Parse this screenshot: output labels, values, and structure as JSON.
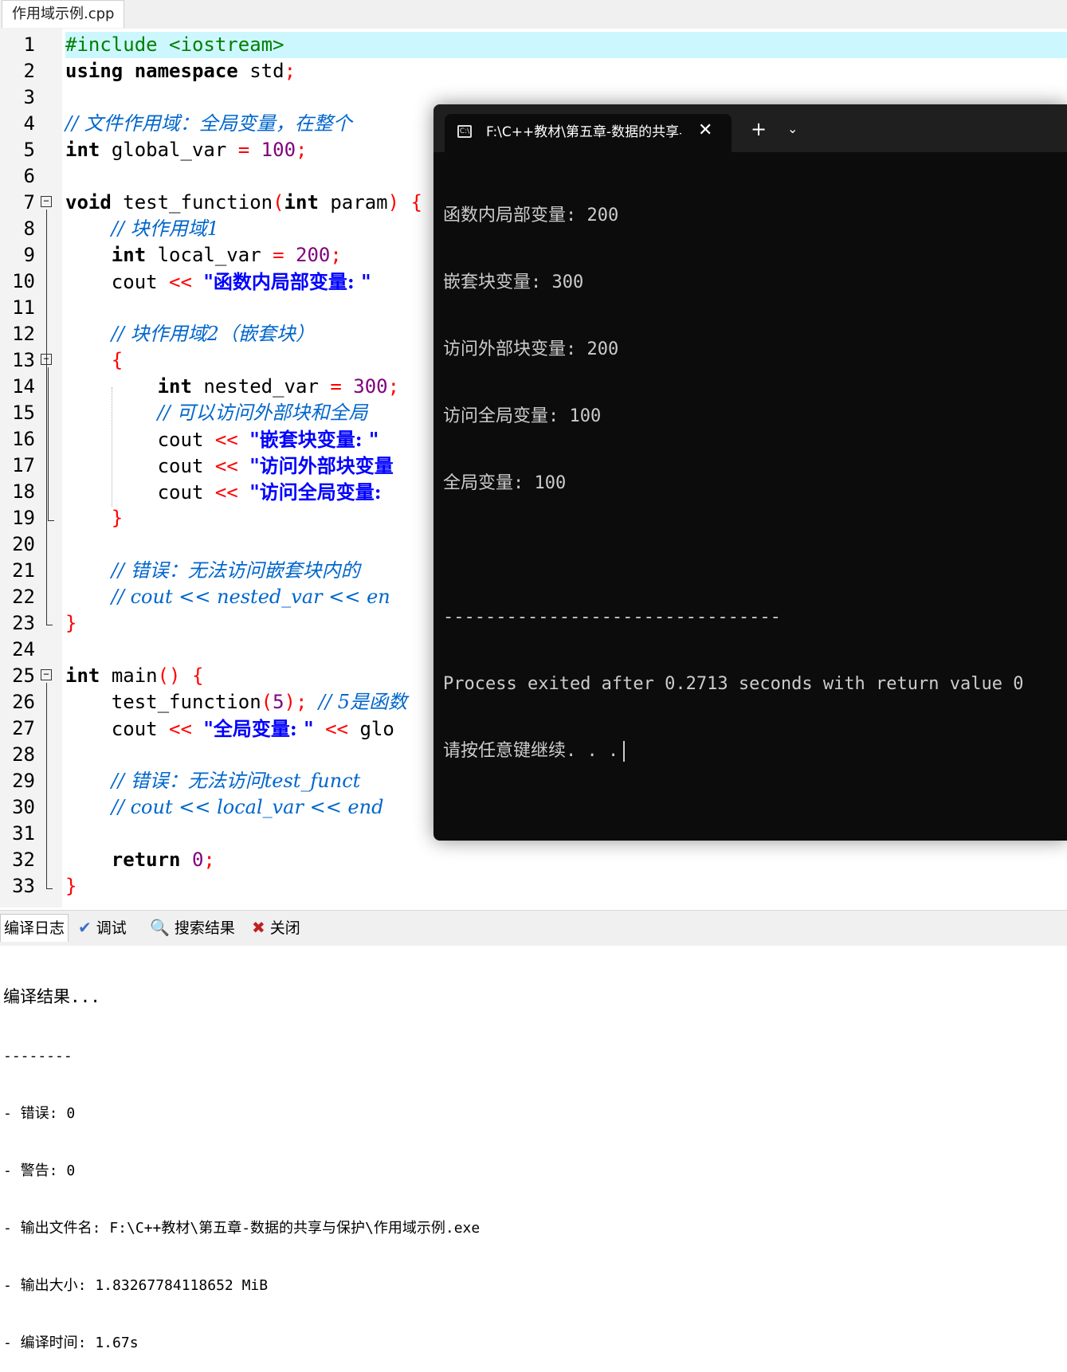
{
  "file_tab": "作用域示例.cpp",
  "code": {
    "l1": {
      "n": "1",
      "pp": "#include <iostream>"
    },
    "l2": {
      "n": "2",
      "kw1": "using",
      "kw2": "namespace",
      "rest": "std",
      "semi": ";"
    },
    "l3": {
      "n": "3"
    },
    "l4": {
      "n": "4",
      "cmt": "// 文件作用域：全局变量，在整个"
    },
    "l5": {
      "n": "5",
      "kw": "int",
      "name": "global_var",
      "eq": "=",
      "num": "100",
      "semi": ";"
    },
    "l6": {
      "n": "6"
    },
    "l7": {
      "n": "7",
      "kw": "void",
      "name": "test_function",
      "p1": "(",
      "kw2": "int",
      "param": "param",
      "p2": ")",
      "brace": "{"
    },
    "l8": {
      "n": "8",
      "cmt": "// 块作用域1"
    },
    "l9": {
      "n": "9",
      "kw": "int",
      "name": "local_var",
      "eq": "=",
      "num": "200",
      "semi": ";"
    },
    "l10": {
      "n": "10",
      "name": "cout",
      "op": "<<",
      "str": "\"函数内局部变量: \""
    },
    "l11": {
      "n": "11"
    },
    "l12": {
      "n": "12",
      "cmt": "// 块作用域2（嵌套块）"
    },
    "l13": {
      "n": "13",
      "brace": "{"
    },
    "l14": {
      "n": "14",
      "kw": "int",
      "name": "nested_var",
      "eq": "=",
      "num": "300",
      "semi": ";"
    },
    "l15": {
      "n": "15",
      "cmt": "// 可以访问外部块和全局"
    },
    "l16": {
      "n": "16",
      "name": "cout",
      "op": "<<",
      "str": "\"嵌套块变量: \""
    },
    "l17": {
      "n": "17",
      "name": "cout",
      "op": "<<",
      "str": "\"访问外部块变量"
    },
    "l18": {
      "n": "18",
      "name": "cout",
      "op": "<<",
      "str": "\"访问全局变量:"
    },
    "l19": {
      "n": "19",
      "brace": "}"
    },
    "l20": {
      "n": "20"
    },
    "l21": {
      "n": "21",
      "cmt": "// 错误：无法访问嵌套块内的"
    },
    "l22": {
      "n": "22",
      "cmt": "// cout << nested_var << en"
    },
    "l23": {
      "n": "23",
      "brace": "}"
    },
    "l24": {
      "n": "24"
    },
    "l25": {
      "n": "25",
      "kw": "int",
      "name": "main",
      "p": "()",
      "brace": "{"
    },
    "l26": {
      "n": "26",
      "name": "test_function",
      "p1": "(",
      "num": "5",
      "p2": ")",
      "semi": ";",
      "cmt": "// 5是函数"
    },
    "l27": {
      "n": "27",
      "name": "cout",
      "op": "<<",
      "str": "\"全局变量: \"",
      "op2": "<<",
      "rest": "glo"
    },
    "l28": {
      "n": "28"
    },
    "l29": {
      "n": "29",
      "cmt": "// 错误：无法访问test_funct"
    },
    "l30": {
      "n": "30",
      "cmt": "// cout << local_var << end"
    },
    "l31": {
      "n": "31"
    },
    "l32": {
      "n": "32",
      "kw": "return",
      "num": "0",
      "semi": ";"
    },
    "l33": {
      "n": "33",
      "brace": "}"
    }
  },
  "console": {
    "tab_title": "F:\\C++教材\\第五章-数据的共享与保护\\作用域示例.exe",
    "tab_icon": "C:\\",
    "close": "✕",
    "new_tab": "+",
    "dropdown": "⌄",
    "lines": [
      "函数内局部变量: 200",
      "嵌套块变量: 300",
      "访问外部块变量: 200",
      "访问全局变量: 100",
      "全局变量: 100",
      "",
      "--------------------------------",
      "Process exited after 0.2713 seconds with return value 0",
      "请按任意键继续. . ."
    ]
  },
  "bottom_tabs": [
    {
      "label": "编译日志",
      "icon": ""
    },
    {
      "label": "调试",
      "icon": "✔"
    },
    {
      "label": "搜索结果",
      "icon": "🔍"
    },
    {
      "label": "关闭",
      "icon": "✖"
    }
  ],
  "log": {
    "title": "编译结果...",
    "sep": "--------",
    "l1": "- 错误: 0",
    "l2": "- 警告: 0",
    "l3": "- 输出文件名: F:\\C++教材\\第五章-数据的共享与保护\\作用域示例.exe",
    "l4": "- 输出大小: 1.83267784118652 MiB",
    "l5": "- 编译时间: 1.67s"
  }
}
